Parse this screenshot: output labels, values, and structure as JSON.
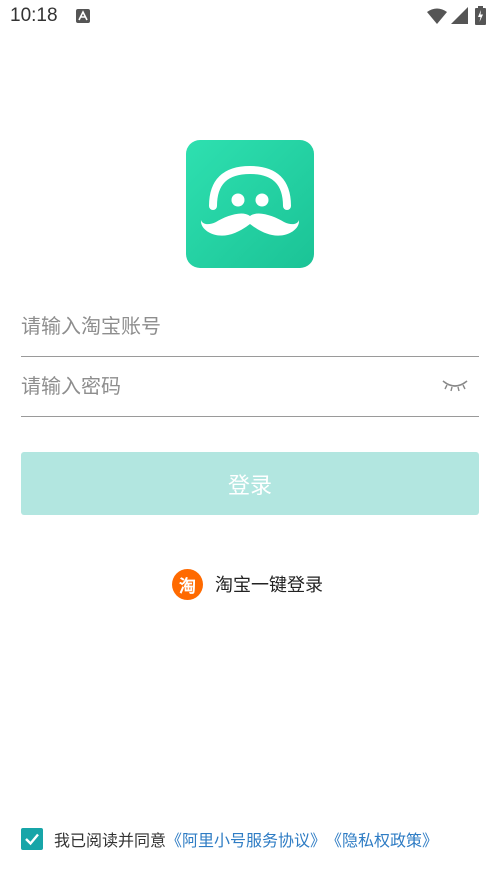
{
  "status_bar": {
    "time": "10:18",
    "icons": [
      "notification-a-icon",
      "wifi-icon",
      "signal-icon",
      "battery-charging-icon"
    ]
  },
  "app": {
    "logo_icon": "mustache-face-icon",
    "brand_color": "#22d2a4"
  },
  "login_form": {
    "account_placeholder": "请输入淘宝账号",
    "password_placeholder": "请输入密码",
    "password_toggle_icon": "eye-closed-icon",
    "login_label": "登录",
    "login_button_color": "#b2e6e0"
  },
  "taobao_quick_login": {
    "icon_char": "淘",
    "label": "淘宝一键登录",
    "icon_color": "#ff6a00"
  },
  "agreement": {
    "checked": true,
    "prefix": "我已阅读并同意",
    "terms_link": "《阿里小号服务协议》",
    "privacy_link": "《隐私权政策》",
    "link_color": "#2e7cc4"
  }
}
